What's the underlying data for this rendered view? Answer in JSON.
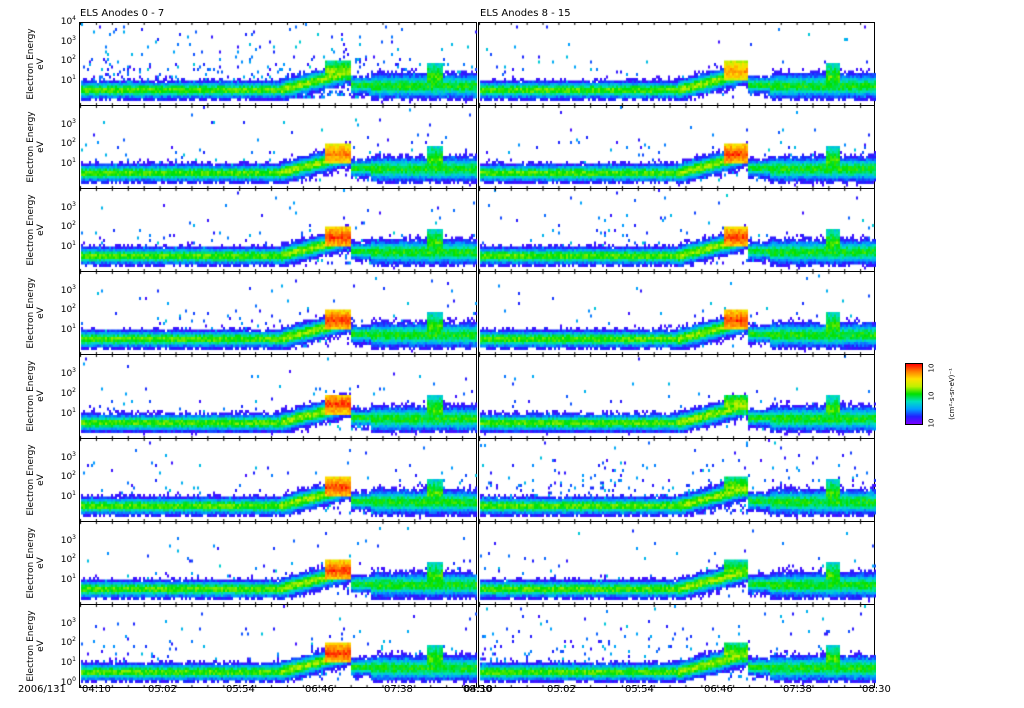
{
  "chart_data": {
    "type": "heatmap",
    "titles": [
      "ELS Anodes 0 - 7",
      "ELS Anodes 8 - 15"
    ],
    "ylabel": "Electron Energy",
    "yunit": "eV",
    "yscale": "log",
    "ylim": [
      0.6,
      10000
    ],
    "yticks": [
      "10",
      "10",
      "10",
      "10",
      "10"
    ],
    "yticks_exp": [
      "0",
      "1",
      "2",
      "3",
      "4"
    ],
    "date_label": "2006/131",
    "xlim": [
      "04:10",
      "08:30"
    ],
    "xticks": [
      "04:10",
      "05:02",
      "05:54",
      "06:46",
      "07:38",
      "08:30"
    ],
    "colorbar": {
      "ticks": [
        "10",
        "10",
        "10"
      ],
      "label": "(cm²-s-sr-eV)⁻¹"
    },
    "rows": 8,
    "columns": 2,
    "features": {
      "background_band_eV": 5,
      "energization_start": "06:20",
      "peak_event": [
        "06:58",
        "07:06"
      ],
      "peak_energy_eV": 40,
      "second_event": "08:00"
    },
    "colormap": [
      "#7a00ff",
      "#2020ff",
      "#00a0ff",
      "#00e0c0",
      "#00e000",
      "#c0f000",
      "#ffe000",
      "#ff8000",
      "#ff0000"
    ]
  }
}
